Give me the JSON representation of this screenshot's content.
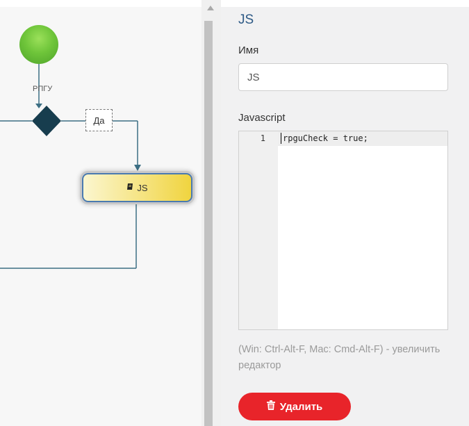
{
  "canvas": {
    "edge_label": "РПГУ",
    "condition_label": "Да",
    "js_node_label": "JS",
    "js_node_icon": "book-icon",
    "start_node_color": "#6fc53a",
    "decision_node_color": "#173d4e"
  },
  "panel": {
    "title": "JS",
    "name_label": "Имя",
    "name_value": "JS",
    "script_label": "Javascript",
    "code_lines": [
      {
        "number": "1",
        "text": "rpguCheck = true;"
      }
    ],
    "hint": "(Win: Ctrl-Alt-F, Mac: Cmd-Alt-F) - увеличить редактор",
    "delete_label": "Удалить",
    "delete_icon": "trash-icon",
    "delete_color": "#e8242a",
    "title_color": "#2e5a86"
  }
}
